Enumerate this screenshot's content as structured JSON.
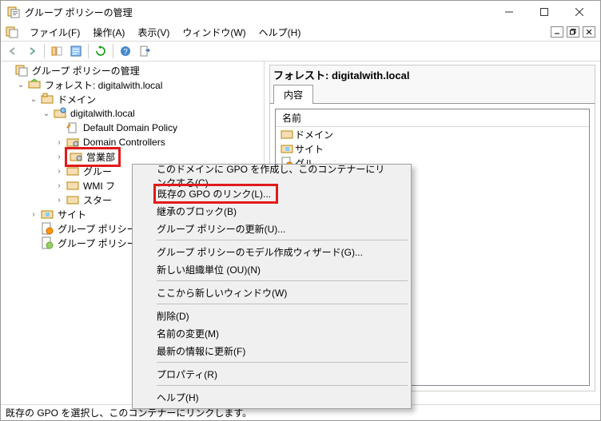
{
  "window": {
    "title": "グループ ポリシーの管理"
  },
  "menu": {
    "file": "ファイル(F)",
    "action": "操作(A)",
    "view": "表示(V)",
    "window": "ウィンドウ(W)",
    "help": "ヘルプ(H)"
  },
  "tree": {
    "root": "グループ ポリシーの管理",
    "forest": "フォレスト: digitalwith.local",
    "domains": "ドメイン",
    "domain": "digitalwith.local",
    "default_policy": "Default Domain Policy",
    "domain_controllers": "Domain Controllers",
    "eigyo": "営業部",
    "group": "グルー",
    "wmi": "WMI フ",
    "starter": "スター",
    "sites": "サイト",
    "gp_policy1": "グループ ポリシー",
    "gp_policy2": "グループ ポリシー"
  },
  "right": {
    "header": "フォレスト: digitalwith.local",
    "tab": "内容",
    "col_name": "名前",
    "row_domain": "ドメイン",
    "row_sites": "サイト",
    "row_cut": "グル"
  },
  "context": {
    "create_link": "このドメインに GPO を作成し、このコンテナーにリンクする(C)...",
    "link_existing": "既存の GPO のリンク(L)...",
    "block_inherit": "継承のブロック(B)",
    "gp_update": "グループ ポリシーの更新(U)...",
    "model_wizard": "グループ ポリシーのモデル作成ウィザード(G)...",
    "new_ou": "新しい組織単位 (OU)(N)",
    "new_window": "ここから新しいウィンドウ(W)",
    "delete": "削除(D)",
    "rename": "名前の変更(M)",
    "refresh": "最新の情報に更新(F)",
    "properties": "プロパティ(R)",
    "help": "ヘルプ(H)"
  },
  "status": "既存の GPO を選択し、このコンテナーにリンクします。"
}
